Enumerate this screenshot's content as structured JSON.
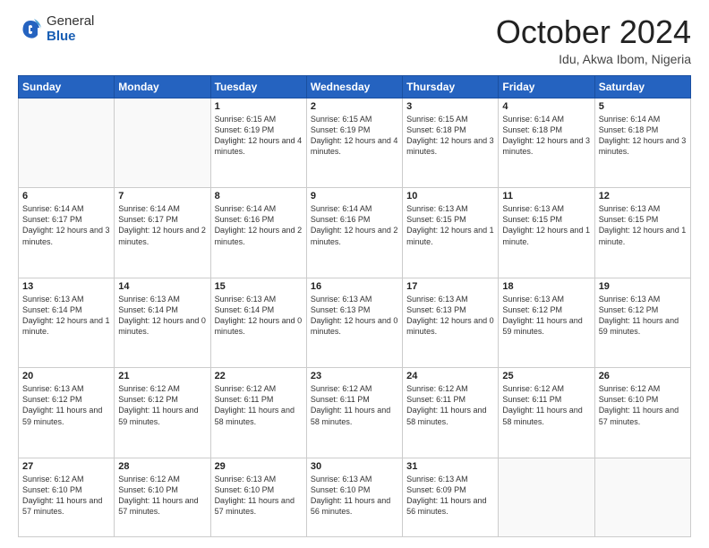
{
  "header": {
    "logo_general": "General",
    "logo_blue": "Blue",
    "month_title": "October 2024",
    "location": "Idu, Akwa Ibom, Nigeria"
  },
  "weekdays": [
    "Sunday",
    "Monday",
    "Tuesday",
    "Wednesday",
    "Thursday",
    "Friday",
    "Saturday"
  ],
  "weeks": [
    [
      {
        "day": "",
        "info": ""
      },
      {
        "day": "",
        "info": ""
      },
      {
        "day": "1",
        "info": "Sunrise: 6:15 AM\nSunset: 6:19 PM\nDaylight: 12 hours and 4 minutes."
      },
      {
        "day": "2",
        "info": "Sunrise: 6:15 AM\nSunset: 6:19 PM\nDaylight: 12 hours and 4 minutes."
      },
      {
        "day": "3",
        "info": "Sunrise: 6:15 AM\nSunset: 6:18 PM\nDaylight: 12 hours and 3 minutes."
      },
      {
        "day": "4",
        "info": "Sunrise: 6:14 AM\nSunset: 6:18 PM\nDaylight: 12 hours and 3 minutes."
      },
      {
        "day": "5",
        "info": "Sunrise: 6:14 AM\nSunset: 6:18 PM\nDaylight: 12 hours and 3 minutes."
      }
    ],
    [
      {
        "day": "6",
        "info": "Sunrise: 6:14 AM\nSunset: 6:17 PM\nDaylight: 12 hours and 3 minutes."
      },
      {
        "day": "7",
        "info": "Sunrise: 6:14 AM\nSunset: 6:17 PM\nDaylight: 12 hours and 2 minutes."
      },
      {
        "day": "8",
        "info": "Sunrise: 6:14 AM\nSunset: 6:16 PM\nDaylight: 12 hours and 2 minutes."
      },
      {
        "day": "9",
        "info": "Sunrise: 6:14 AM\nSunset: 6:16 PM\nDaylight: 12 hours and 2 minutes."
      },
      {
        "day": "10",
        "info": "Sunrise: 6:13 AM\nSunset: 6:15 PM\nDaylight: 12 hours and 1 minute."
      },
      {
        "day": "11",
        "info": "Sunrise: 6:13 AM\nSunset: 6:15 PM\nDaylight: 12 hours and 1 minute."
      },
      {
        "day": "12",
        "info": "Sunrise: 6:13 AM\nSunset: 6:15 PM\nDaylight: 12 hours and 1 minute."
      }
    ],
    [
      {
        "day": "13",
        "info": "Sunrise: 6:13 AM\nSunset: 6:14 PM\nDaylight: 12 hours and 1 minute."
      },
      {
        "day": "14",
        "info": "Sunrise: 6:13 AM\nSunset: 6:14 PM\nDaylight: 12 hours and 0 minutes."
      },
      {
        "day": "15",
        "info": "Sunrise: 6:13 AM\nSunset: 6:14 PM\nDaylight: 12 hours and 0 minutes."
      },
      {
        "day": "16",
        "info": "Sunrise: 6:13 AM\nSunset: 6:13 PM\nDaylight: 12 hours and 0 minutes."
      },
      {
        "day": "17",
        "info": "Sunrise: 6:13 AM\nSunset: 6:13 PM\nDaylight: 12 hours and 0 minutes."
      },
      {
        "day": "18",
        "info": "Sunrise: 6:13 AM\nSunset: 6:12 PM\nDaylight: 11 hours and 59 minutes."
      },
      {
        "day": "19",
        "info": "Sunrise: 6:13 AM\nSunset: 6:12 PM\nDaylight: 11 hours and 59 minutes."
      }
    ],
    [
      {
        "day": "20",
        "info": "Sunrise: 6:13 AM\nSunset: 6:12 PM\nDaylight: 11 hours and 59 minutes."
      },
      {
        "day": "21",
        "info": "Sunrise: 6:12 AM\nSunset: 6:12 PM\nDaylight: 11 hours and 59 minutes."
      },
      {
        "day": "22",
        "info": "Sunrise: 6:12 AM\nSunset: 6:11 PM\nDaylight: 11 hours and 58 minutes."
      },
      {
        "day": "23",
        "info": "Sunrise: 6:12 AM\nSunset: 6:11 PM\nDaylight: 11 hours and 58 minutes."
      },
      {
        "day": "24",
        "info": "Sunrise: 6:12 AM\nSunset: 6:11 PM\nDaylight: 11 hours and 58 minutes."
      },
      {
        "day": "25",
        "info": "Sunrise: 6:12 AM\nSunset: 6:11 PM\nDaylight: 11 hours and 58 minutes."
      },
      {
        "day": "26",
        "info": "Sunrise: 6:12 AM\nSunset: 6:10 PM\nDaylight: 11 hours and 57 minutes."
      }
    ],
    [
      {
        "day": "27",
        "info": "Sunrise: 6:12 AM\nSunset: 6:10 PM\nDaylight: 11 hours and 57 minutes."
      },
      {
        "day": "28",
        "info": "Sunrise: 6:12 AM\nSunset: 6:10 PM\nDaylight: 11 hours and 57 minutes."
      },
      {
        "day": "29",
        "info": "Sunrise: 6:13 AM\nSunset: 6:10 PM\nDaylight: 11 hours and 57 minutes."
      },
      {
        "day": "30",
        "info": "Sunrise: 6:13 AM\nSunset: 6:10 PM\nDaylight: 11 hours and 56 minutes."
      },
      {
        "day": "31",
        "info": "Sunrise: 6:13 AM\nSunset: 6:09 PM\nDaylight: 11 hours and 56 minutes."
      },
      {
        "day": "",
        "info": ""
      },
      {
        "day": "",
        "info": ""
      }
    ]
  ]
}
